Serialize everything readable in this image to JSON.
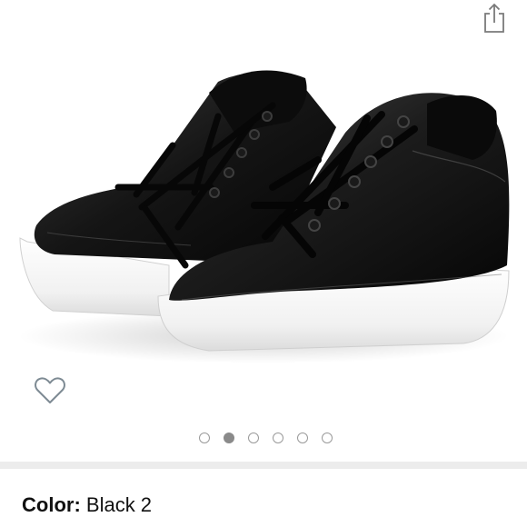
{
  "icons": {
    "share": "share-icon",
    "wishlist": "heart-outline-icon"
  },
  "carousel": {
    "count": 6,
    "active_index": 1
  },
  "variant": {
    "label": "Color:",
    "value": "Black 2"
  },
  "colors": {
    "icon_stroke": "#7a7a7a",
    "divider": "#ececec",
    "dot_active": "#8a8a8a",
    "dot_border": "#9a9a9a"
  }
}
